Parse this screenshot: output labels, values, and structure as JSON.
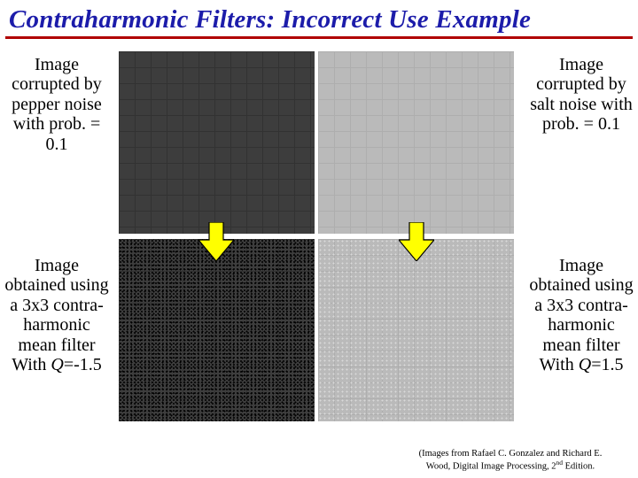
{
  "title": "Contraharmonic Filters: Incorrect Use Example",
  "captions": {
    "top_left": "Image corrupted by pepper noise with prob. = 0.1",
    "top_right": "Image corrupted by salt noise with prob. = 0.1",
    "bottom_left_pre": "Image obtained using a 3x3 contra- harmonic mean filter With ",
    "bottom_left_q": "Q",
    "bottom_left_post": "=-1.5",
    "bottom_right_pre": "Image obtained using a 3x3 contra- harmonic mean filter With ",
    "bottom_right_q": "Q",
    "bottom_right_post": "=1.5"
  },
  "attribution": {
    "line1": "(Images from Rafael C. Gonzalez and Richard E.",
    "line2_pre": "Wood, Digital Image Processing, 2",
    "line2_sup": "nd",
    "line2_post": " Edition."
  }
}
